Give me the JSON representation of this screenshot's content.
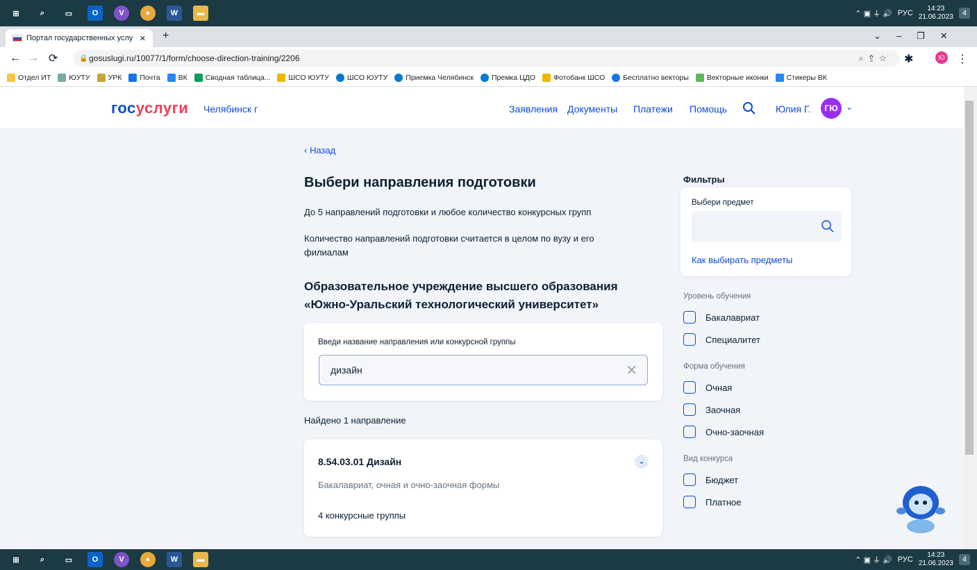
{
  "taskbar": {
    "clock_time": "14:23",
    "clock_date": "21.06.2023",
    "lang": "РУС",
    "notif_count": "4"
  },
  "browser": {
    "tab_title": "Портал государственных услуг",
    "url": "gosuslugi.ru/10077/1/form/choose-direction-training/2206",
    "bookmarks": [
      "Отдел ИТ",
      "ЮУТУ",
      "УРК",
      "Почта",
      "ВК",
      "Сводная таблица...",
      "ШСО ЮУТУ",
      "ШСО ЮУТУ",
      "Приемка Челябинск",
      "Премка ЦДО",
      "Фотобанк ШСО",
      "Бесплатно векторы",
      "Векторные иконки",
      "Стикеры ВК"
    ]
  },
  "header": {
    "logo_a": "гос",
    "logo_b": "услуги",
    "city": "Челябинск г",
    "nav": [
      "Заявления",
      "Документы",
      "Платежи",
      "Помощь"
    ],
    "user": "Юлия Г.",
    "avatar": "ГЮ"
  },
  "main": {
    "back": "Назад",
    "title": "Выбери направления подготовки",
    "note1": "До 5 направлений подготовки и любое количество конкурсных групп",
    "note2": "Количество направлений подготовки считается в целом по вузу и его филиалам",
    "university": "Образовательное учреждение высшего образования «Южно-Уральский технологический университет»",
    "search_label": "Введи название направления или конкурсной группы",
    "search_value": "дизайн",
    "found": "Найдено 1 направление",
    "result": {
      "title": "8.54.03.01 Дизайн",
      "desc": "Бакалавриат, очная и очно-заочная формы",
      "groups": "4 конкурсные группы"
    }
  },
  "filters": {
    "title": "Фильтры",
    "subject_label": "Выбери предмет",
    "subject_link": "Как выбирать предметы",
    "level_label": "Уровень обучения",
    "levels": [
      "Бакалавриат",
      "Специалитет"
    ],
    "form_label": "Форма обучения",
    "forms": [
      "Очная",
      "Заочная",
      "Очно-заочная"
    ],
    "contest_label": "Вид конкурса",
    "contests": [
      "Бюджет",
      "Платное"
    ]
  },
  "colors": {
    "accent": "#0d4cd3",
    "logo_red": "#ee3f58",
    "avatar": "#9b2ef5"
  }
}
